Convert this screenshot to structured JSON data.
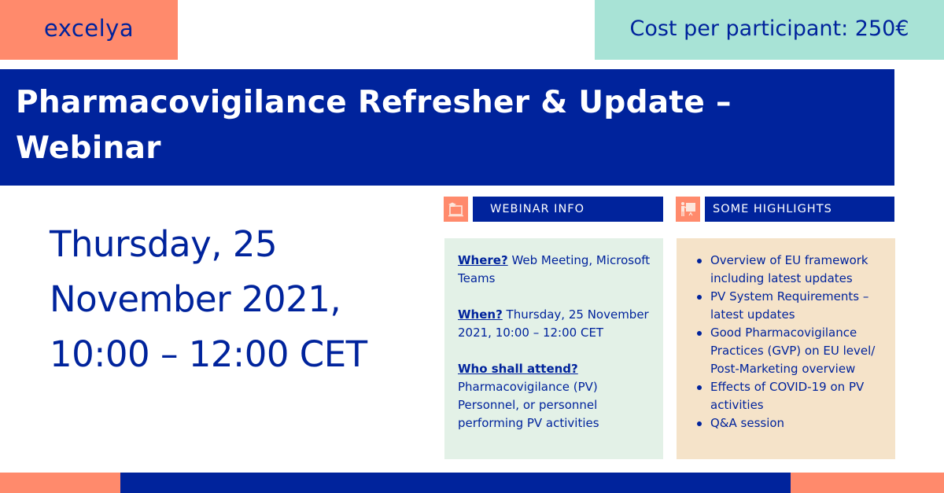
{
  "brand": {
    "logo_text": "excelya",
    "colors": {
      "navy": "#00239c",
      "coral": "#ff8a6c",
      "mint": "#a8e3d6",
      "pale_green": "#e3f1e7",
      "pale_beige": "#f5e3c9"
    }
  },
  "cost": {
    "label": "Cost per participant: 250€"
  },
  "title": {
    "line1": "Pharmacovigilance Refresher & Update –",
    "line2": "Webinar"
  },
  "date": {
    "line1": "Thursday, 25",
    "line2": "November 2021,",
    "line3": "10:00 – 12:00 CET"
  },
  "webinar_info": {
    "header": "WEBINAR INFO",
    "icon": "laptop-graduation-cap-icon",
    "items": [
      {
        "key": "Where?",
        "value": " Web Meeting, Microsoft Teams"
      },
      {
        "key": "When?",
        "value": " Thursday, 25 November 2021, 10:00 – 12:00 CET"
      },
      {
        "key": "Who shall attend?",
        "value": "Pharmacovigilance (PV) Personnel, or personnel performing PV activities"
      }
    ]
  },
  "highlights": {
    "header": "SOME HIGHLIGHTS",
    "icon": "presenter-board-icon",
    "items": [
      "Overview of EU framework including latest updates",
      "PV System Requirements – latest updates",
      "Good Pharmacovigilance Practices (GVP) on EU level/ Post-Marketing overview",
      "Effects of COVID-19 on PV activities",
      "Q&A session"
    ]
  }
}
